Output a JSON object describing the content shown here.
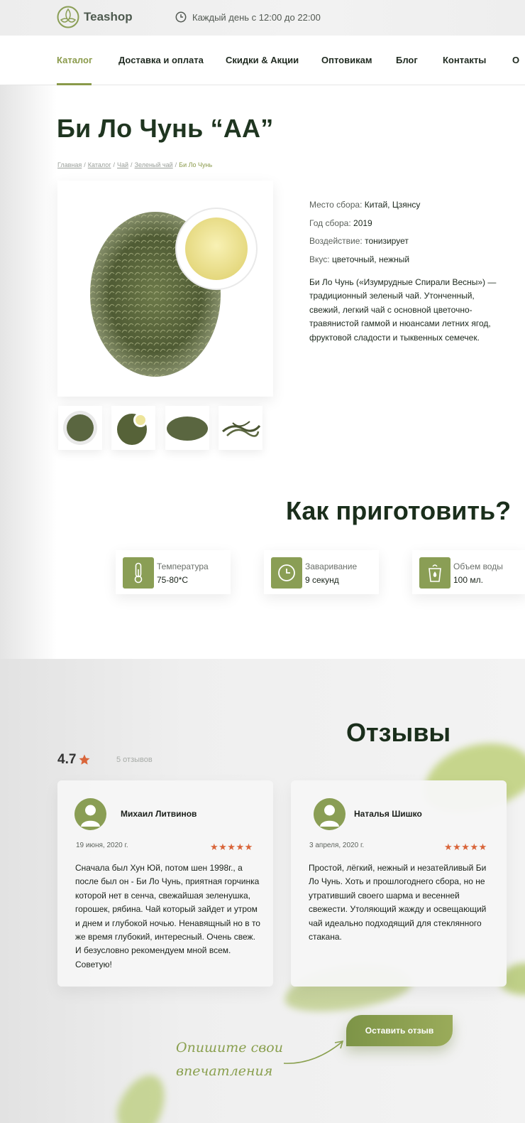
{
  "header": {
    "logo_text": "Teashop",
    "hours": "Каждый день с 12:00 до 22:00",
    "nav": [
      "Каталог",
      "Доставка и оплата",
      "Скидки & Акции",
      "Оптовикам",
      "Блог",
      "Контакты",
      "О"
    ],
    "active_nav": "Каталог"
  },
  "product": {
    "title": "Би Ло Чунь “АА”",
    "breadcrumb": [
      "Главная",
      "Каталог",
      "Чай",
      "Зеленый чай"
    ],
    "breadcrumb_current": "Би Ло Чунь",
    "properties": [
      {
        "label": "Место сбора:",
        "value": "Китай, Цзянсу"
      },
      {
        "label": "Год сбора:",
        "value": "2019"
      },
      {
        "label": "Воздействие:",
        "value": "тонизирует"
      },
      {
        "label": "Вкус:",
        "value": "цветочный, нежный"
      }
    ],
    "description": "Би Ло Чунь («Изумрудные Спирали Весны») — традиционный зеленый чай. Утонченный, свежий, легкий чай с основной цветочно- травянистой гаммой и нюансами летних ягод, фруктовой сладости и тыквенных семечек."
  },
  "brew": {
    "title": "Как приготовить?",
    "items": [
      {
        "icon": "thermometer-icon",
        "label": "Температура",
        "value": "75-80*С"
      },
      {
        "icon": "clock-icon",
        "label": "Заваривание",
        "value": "9 секунд"
      },
      {
        "icon": "cup-icon",
        "label": "Объем воды",
        "value": "100 мл."
      }
    ]
  },
  "reviews": {
    "title": "Отзывы",
    "rating": "4.7",
    "count": "5 отзывов",
    "items": [
      {
        "name": "Михаил Литвинов",
        "date": "19 июня, 2020 г.",
        "stars": "★★★★★",
        "text": "Сначала был Хун Юй, потом шен 1998г., а после был он - Би Ло Чунь, приятная горчинка которой нет в сенча, свежайшая зеленушка, горошек, рябина. Чай который зайдет и утром и днем и глубокой ночью. Ненавящный но в то же время глубокий, интересный. Очень свеж. И безусловно рекомендуем мной всем. Советую!"
      },
      {
        "name": "Наталья Шишко",
        "date": "3 апреля, 2020 г.",
        "stars": "★★★★★",
        "text": "Простой, лёгкий, нежный и незатейливый Би Ло Чунь. Хоть и прошлогоднего сбора, но не утративший своего шарма и весенней свежести. Утоляющий жажду и освещающий чай идеально подходящий для стеклянного стакана."
      }
    ],
    "cta": "Оставить отзыв",
    "handwritten": "Опишите свои впечатления"
  },
  "colors": {
    "accent": "#8a9e55",
    "star": "#d9653a",
    "title": "#1f3520"
  }
}
